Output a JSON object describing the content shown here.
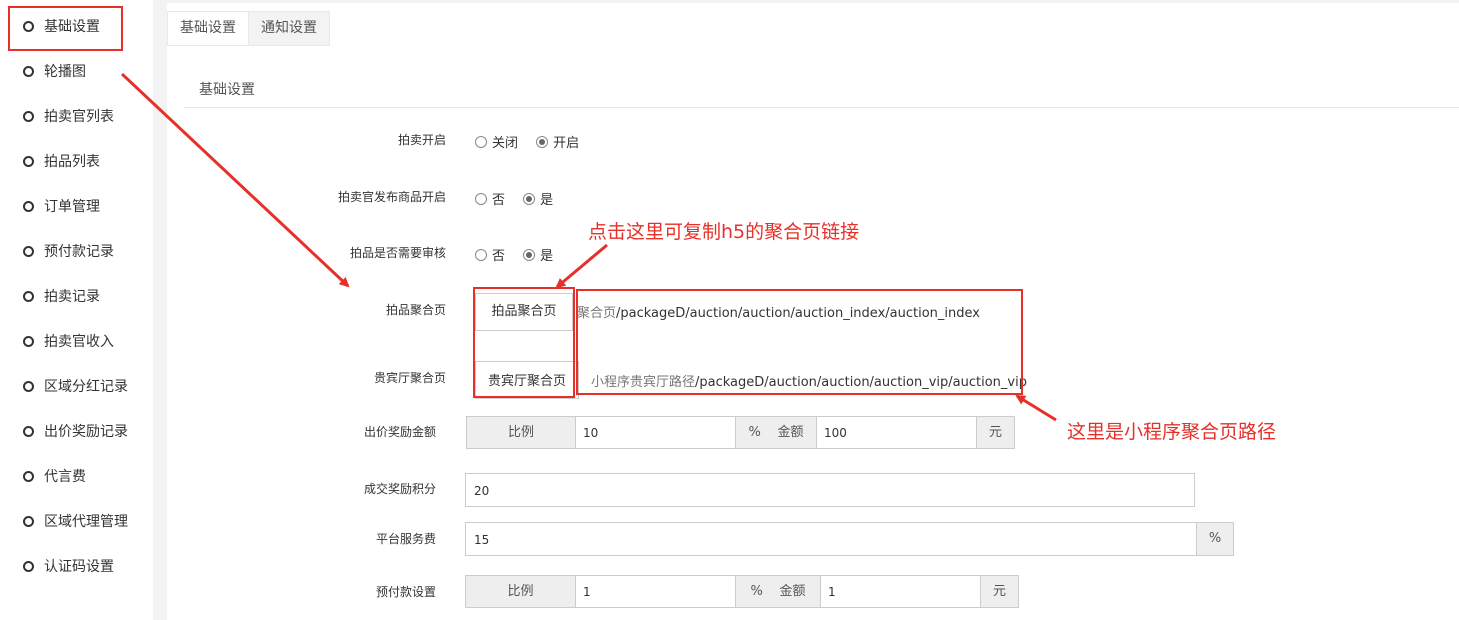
{
  "sidebar": {
    "items": [
      {
        "label": "基础设置"
      },
      {
        "label": "轮播图"
      },
      {
        "label": "拍卖官列表"
      },
      {
        "label": "拍品列表"
      },
      {
        "label": "订单管理"
      },
      {
        "label": "预付款记录"
      },
      {
        "label": "拍卖记录"
      },
      {
        "label": "拍卖官收入"
      },
      {
        "label": "区域分红记录"
      },
      {
        "label": "出价奖励记录"
      },
      {
        "label": "代言费"
      },
      {
        "label": "区域代理管理"
      },
      {
        "label": "认证码设置"
      }
    ]
  },
  "tabs": {
    "basic": "基础设置",
    "notice": "通知设置"
  },
  "section_title": "基础设置",
  "form": {
    "auction_open": {
      "label": "拍卖开启",
      "options": [
        "关闭",
        "开启"
      ],
      "selected": "开启"
    },
    "officer_publish": {
      "label": "拍卖官发布商品开启",
      "options": [
        "否",
        "是"
      ],
      "selected": "是"
    },
    "need_review": {
      "label": "拍品是否需要审核",
      "options": [
        "否",
        "是"
      ],
      "selected": "是"
    },
    "aggregate_page": {
      "label": "拍品聚合页",
      "button": "拍品聚合页",
      "path_prefix": "聚合页",
      "path": "/packageD/auction/auction/auction_index/auction_index"
    },
    "vip_page": {
      "label": "贵宾厅聚合页",
      "button": "贵宾厅聚合页",
      "path_prefix": "小程序贵宾厅路径",
      "path": "/packageD/auction/auction/auction_vip/auction_vip"
    },
    "bid_reward": {
      "label": "出价奖励金额",
      "ratio_label": "比例",
      "ratio_value": "10",
      "percent": "%",
      "amount_label": "金额",
      "amount_value": "100",
      "unit": "元"
    },
    "deal_points": {
      "label": "成交奖励积分",
      "value": "20"
    },
    "service_fee": {
      "label": "平台服务费",
      "value": "15",
      "unit": "%"
    },
    "prepay": {
      "label": "预付款设置",
      "ratio_label": "比例",
      "ratio_value": "1",
      "percent": "%",
      "amount_label": "金额",
      "amount_value": "1",
      "unit": "元"
    }
  },
  "annotations": {
    "copy_h5": "点击这里可复制h5的聚合页链接",
    "mini_path": "这里是小程序聚合页路径"
  },
  "colors": {
    "annotation": "#e5312a"
  }
}
